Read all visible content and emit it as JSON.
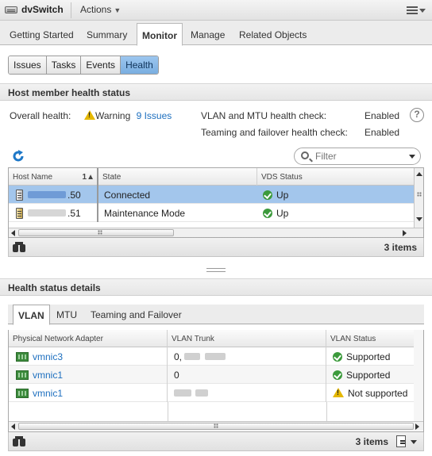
{
  "titlebar": {
    "title": "dvSwitch",
    "actions_label": "Actions"
  },
  "main_tabs": [
    {
      "label": "Getting Started"
    },
    {
      "label": "Summary"
    },
    {
      "label": "Monitor",
      "active": true
    },
    {
      "label": "Manage"
    },
    {
      "label": "Related Objects"
    }
  ],
  "sub_tabs": [
    {
      "label": "Issues"
    },
    {
      "label": "Tasks"
    },
    {
      "label": "Events"
    },
    {
      "label": "Health",
      "active": true
    }
  ],
  "host_health": {
    "section_title": "Host member health status",
    "overall_label": "Overall health:",
    "overall_value": "Warning",
    "issues_link": "9 Issues",
    "vlan_mtu_label": "VLAN and MTU health check:",
    "vlan_mtu_value": "Enabled",
    "teaming_label": "Teaming and failover health check:",
    "teaming_value": "Enabled",
    "filter_placeholder": "Filter",
    "columns": [
      "Host Name",
      "State",
      "VDS Status"
    ],
    "sort_indicator": "1",
    "rows": [
      {
        "host_suffix": ".50",
        "state": "Connected",
        "vds_status": "Up",
        "selected": true
      },
      {
        "host_suffix": ".51",
        "state": "Maintenance Mode",
        "vds_status": "Up",
        "selected": false
      }
    ],
    "item_count": "3 items"
  },
  "details": {
    "section_title": "Health status details",
    "tabs": [
      {
        "label": "VLAN",
        "active": true
      },
      {
        "label": "MTU"
      },
      {
        "label": "Teaming and Failover"
      }
    ],
    "columns": [
      "Physical Network Adapter",
      "VLAN Trunk",
      "VLAN Status"
    ],
    "rows": [
      {
        "adapter": "vmnic3",
        "trunk": "0,",
        "status": "Supported",
        "status_kind": "ok"
      },
      {
        "adapter": "vmnic1",
        "trunk": "0",
        "status": "Supported",
        "status_kind": "ok"
      },
      {
        "adapter": "vmnic1",
        "trunk": "",
        "status": "Not supported",
        "status_kind": "warning"
      }
    ],
    "item_count": "3 items"
  },
  "colors": {
    "selection": "#a3c6ec",
    "link": "#1d6fbf",
    "ok": "#3c9a3c",
    "warning": "#e5b800",
    "active_subtab": "#7aaee0"
  }
}
